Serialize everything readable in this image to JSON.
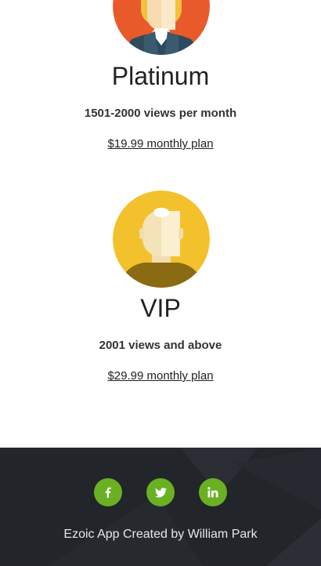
{
  "plans": [
    {
      "name": "Platinum",
      "views": "1501-2000 views per month",
      "link": "$19.99 monthly plan"
    },
    {
      "name": "VIP",
      "views": "2001 views and above",
      "link": "$29.99 monthly plan"
    }
  ],
  "footer": {
    "credit": "Ezoic App Created by William Park",
    "social": [
      {
        "icon": "facebook-icon",
        "glyph": "f"
      },
      {
        "icon": "twitter-icon",
        "glyph": "t"
      },
      {
        "icon": "linkedin-icon",
        "glyph": "in"
      }
    ]
  },
  "colors": {
    "accent_green": "#6ab023",
    "footer_bg": "#22252a",
    "platinum_avatar_bg": "#e85a2a",
    "vip_avatar_bg": "#f3c12c"
  }
}
